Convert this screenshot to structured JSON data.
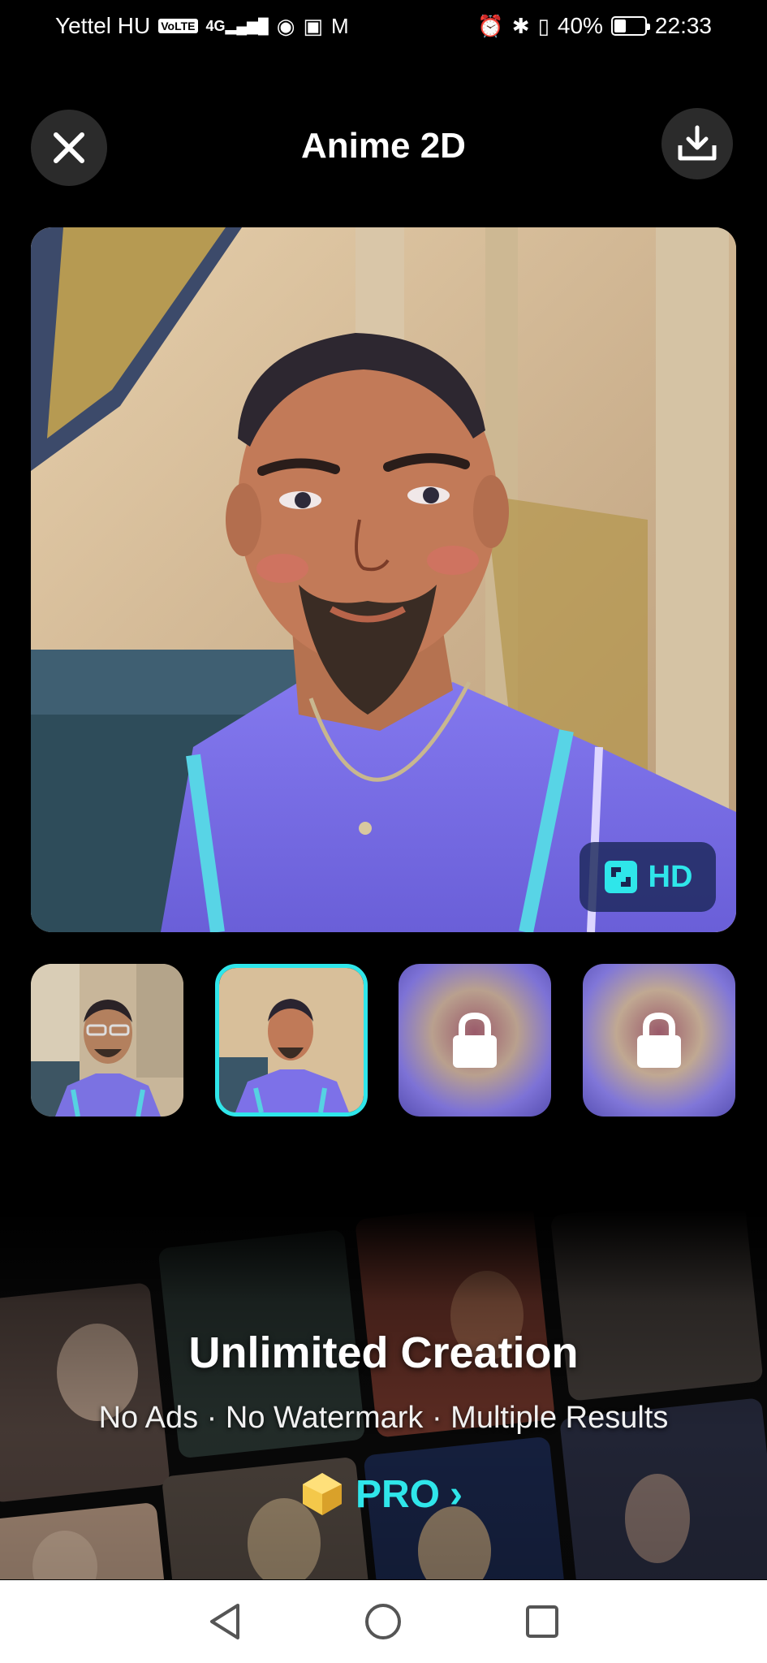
{
  "status_bar": {
    "carrier": "Yettel HU",
    "volte": "VoLTE",
    "network": "4G",
    "battery_percent": "40%",
    "battery_level": 0.4,
    "time": "22:33"
  },
  "header": {
    "title": "Anime 2D",
    "close_icon": "close-icon",
    "download_icon": "download-icon"
  },
  "main_image": {
    "hd_label": "HD"
  },
  "thumbnails": [
    {
      "kind": "original-photo",
      "locked": false,
      "selected": false
    },
    {
      "kind": "anime-result",
      "locked": false,
      "selected": true
    },
    {
      "kind": "locked-result",
      "locked": true,
      "selected": false
    },
    {
      "kind": "locked-result",
      "locked": true,
      "selected": false
    }
  ],
  "promo": {
    "title": "Unlimited Creation",
    "subtitle": "No Ads · No Watermark · Multiple Results",
    "pro_label": "PRO",
    "pro_arrow": "›"
  },
  "colors": {
    "accent": "#2fe6ea",
    "background": "#000000",
    "button_bg": "#2b2b2b",
    "shirt": "#7a6ee6"
  },
  "nav_bar": {
    "back_icon": "back-triangle-icon",
    "home_icon": "home-circle-icon",
    "recents_icon": "recents-square-icon"
  }
}
